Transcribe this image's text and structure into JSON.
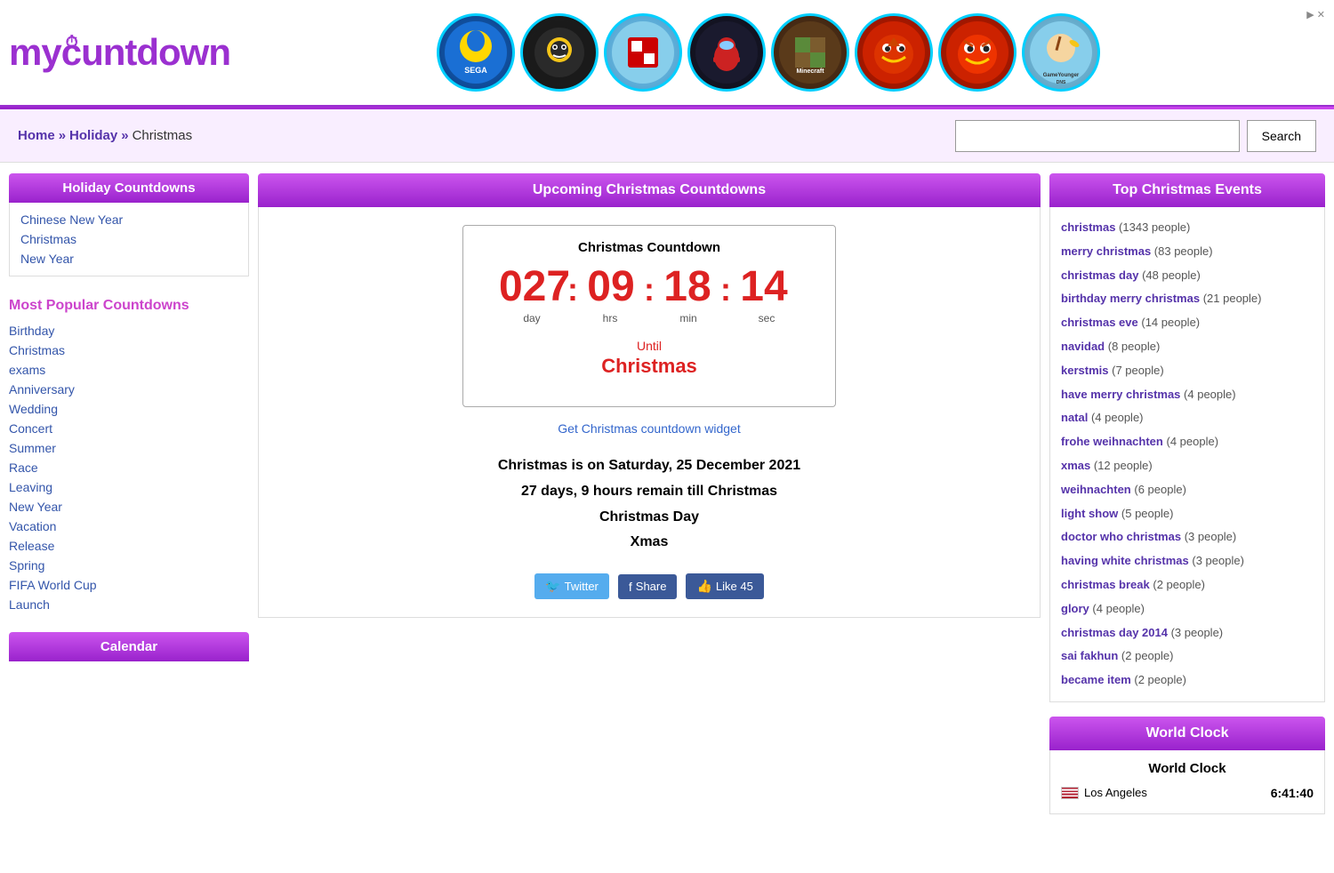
{
  "site": {
    "logo": "mycountdown",
    "logo_icon": "⏱"
  },
  "ad_banner": {
    "close_label": "✕",
    "ad_indicator": "Ad ▶ ✕",
    "games": [
      {
        "name": "SEGA",
        "style": "sega"
      },
      {
        "name": "Brawl Stars",
        "style": "brawl"
      },
      {
        "name": "Roblox",
        "style": "roblox"
      },
      {
        "name": "Among Us",
        "style": "among"
      },
      {
        "name": "Minecraft",
        "style": "minecraft"
      },
      {
        "name": "Angry Birds",
        "style": "angryred"
      },
      {
        "name": "Angry Birds 2",
        "style": "angry2"
      },
      {
        "name": "GameYounger",
        "style": "gameyounger"
      }
    ]
  },
  "breadcrumb": {
    "home": "Home",
    "sep1": "»",
    "holiday": "Holiday",
    "sep2": "»",
    "current": "Christmas"
  },
  "search": {
    "placeholder": "",
    "button_label": "Search"
  },
  "left_sidebar": {
    "holiday_title": "Holiday Countdowns",
    "holiday_links": [
      "Chinese New Year",
      "Christmas",
      "New Year"
    ],
    "popular_title": "Most Popular Countdowns",
    "popular_links": [
      "Birthday",
      "Christmas",
      "exams",
      "Anniversary",
      "Wedding",
      "Concert",
      "Summer",
      "Race",
      "Leaving",
      "New Year",
      "Vacation",
      "Release",
      "Spring",
      "FIFA World Cup",
      "Launch"
    ],
    "calendar_title": "Calendar"
  },
  "center": {
    "section_title": "Upcoming Christmas Countdowns",
    "countdown": {
      "label": "Christmas Countdown",
      "days": "027",
      "hours": "09",
      "minutes": "18",
      "seconds": "14",
      "day_label": "day",
      "hrs_label": "hrs",
      "min_label": "min",
      "sec_label": "sec",
      "until_label": "Until",
      "event_name": "Christmas",
      "widget_link": "Get Christmas countdown widget"
    },
    "event_info_line1": "Christmas is on  Saturday, 25 December 2021",
    "event_info_line2": "27 days, 9 hours remain till Christmas",
    "event_info_line3": "Christmas Day",
    "event_info_line4": "Xmas",
    "social": {
      "twitter_label": "Twitter",
      "share_label": "Share",
      "like_label": "Like 45"
    }
  },
  "right_sidebar": {
    "events_title": "Top Christmas Events",
    "events": [
      {
        "name": "christmas",
        "count": "1343 people"
      },
      {
        "name": "merry christmas",
        "count": "83 people"
      },
      {
        "name": "christmas day",
        "count": "48 people"
      },
      {
        "name": "birthday merry christmas",
        "count": "21 people"
      },
      {
        "name": "christmas eve",
        "count": "14 people"
      },
      {
        "name": "navidad",
        "count": "8 people"
      },
      {
        "name": "kerstmis",
        "count": "7 people"
      },
      {
        "name": "have merry christmas",
        "count": "4 people"
      },
      {
        "name": "natal",
        "count": "4 people"
      },
      {
        "name": "frohe weihnachten",
        "count": "4 people"
      },
      {
        "name": "xmas",
        "count": "12 people"
      },
      {
        "name": "weihnachten",
        "count": "6 people"
      },
      {
        "name": "light show",
        "count": "5 people"
      },
      {
        "name": "doctor who christmas",
        "count": "3 people"
      },
      {
        "name": "having white christmas",
        "count": "3 people"
      },
      {
        "name": "christmas break",
        "count": "2 people"
      },
      {
        "name": "glory",
        "count": "4 people"
      },
      {
        "name": "christmas day 2014",
        "count": "3 people"
      },
      {
        "name": "sai fakhun",
        "count": "2 people"
      },
      {
        "name": "became item",
        "count": "2 people"
      }
    ],
    "world_clock_title": "World Clock",
    "world_clock_subtitle": "World Clock",
    "clock_city": "Los Angeles",
    "clock_time": "6:41:40"
  }
}
